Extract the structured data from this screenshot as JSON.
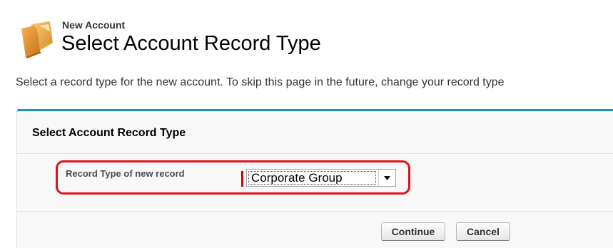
{
  "header": {
    "subtitle": "New Account",
    "title": "Select Account Record Type",
    "icon": "folder-icon"
  },
  "description": "Select a record type for the new account. To skip this page in the future, change your record type",
  "panel": {
    "title": "Select Account Record Type",
    "field": {
      "label": "Record Type of new record",
      "selected_value": "Corporate Group",
      "required": true
    },
    "buttons": {
      "continue_label": "Continue",
      "cancel_label": "Cancel"
    }
  },
  "colors": {
    "panel_accent": "#1797c0",
    "required_indicator": "#cc0000",
    "highlight": "#e2101b"
  }
}
